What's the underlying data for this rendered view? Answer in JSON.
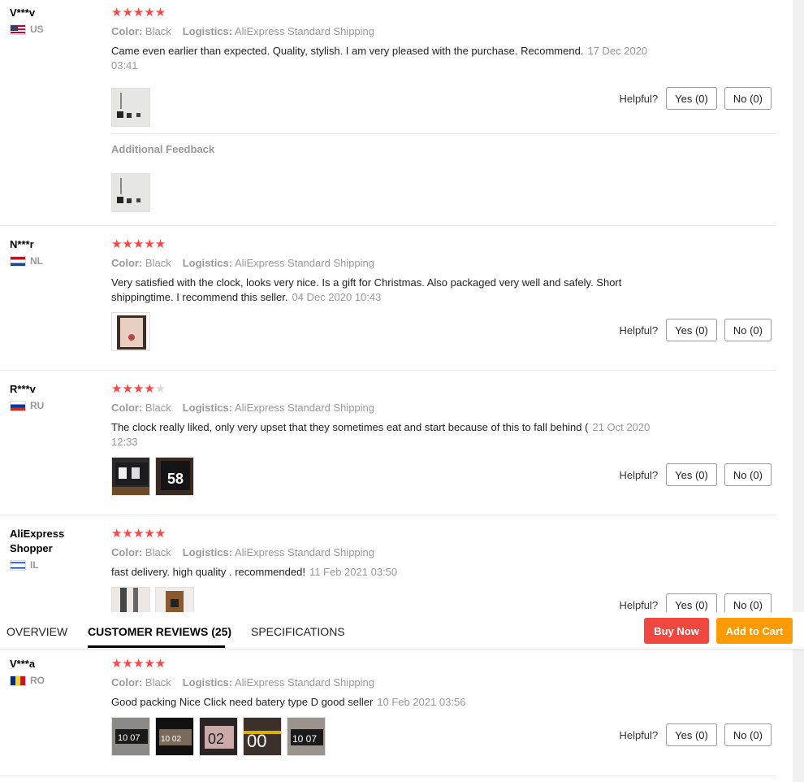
{
  "helpful_label": "Helpful?",
  "labels": {
    "color": "Color:",
    "logistics": "Logistics:"
  },
  "additional_feedback": "Additional Feedback",
  "reviews": [
    {
      "user": "V***v",
      "country": "US",
      "stars": "★★★★★",
      "stars_off": "",
      "rating": 5,
      "color": "Black",
      "logistics": "AliExpress Standard Shipping",
      "text": "Came even earlier than expected. Quality, stylish. I am very pleased with the purchase. Recommend.",
      "date": "17 Dec 2020 03:41",
      "yes": "Yes (0)",
      "no": "No (0)"
    },
    {
      "user": "N***r",
      "country": "NL",
      "stars": "★★★★★",
      "stars_off": "",
      "rating": 5,
      "color": "Black",
      "logistics": "AliExpress Standard Shipping",
      "text": "Very satisfied with the clock, looks very nice. Is a gift for Christmas. Also packaged very well and safely. Short shippingtime. I recommend this seller.",
      "date": "04 Dec 2020 10:43",
      "yes": "Yes (0)",
      "no": "No (0)"
    },
    {
      "user": "R***v",
      "country": "RU",
      "stars": "★★★★",
      "stars_off": "★",
      "rating": 4,
      "color": "Black",
      "logistics": "AliExpress Standard Shipping",
      "text": "The clock really liked, only very upset that they sometimes eat and start because of this to fall behind (",
      "date": "21 Oct 2020 12:33",
      "yes": "Yes (0)",
      "no": "No (0)"
    },
    {
      "user": "AliExpress Shopper",
      "country": "IL",
      "stars": "★★★★★",
      "stars_off": "",
      "rating": 5,
      "color": "Black",
      "logistics": "AliExpress Standard Shipping",
      "text": "fast delivery. high quality . recommended!",
      "date": "11 Feb 2021 03:50",
      "yes": "Yes (0)",
      "no": "No (0)"
    },
    {
      "user": "V***a",
      "country": "RO",
      "stars": "★★★★★",
      "stars_off": "",
      "rating": 5,
      "color": "Black",
      "logistics": "AliExpress Standard Shipping",
      "text": "Good packing Nice Click need batery type D good seller",
      "date": "10 Feb 2021 03:56",
      "yes": "Yes (0)",
      "no": "No (0)"
    }
  ],
  "tabs": {
    "overview": "OVERVIEW",
    "reviews": "CUSTOMER REVIEWS (25)",
    "specs": "SPECIFICATIONS"
  },
  "actions": {
    "buy": "Buy Now",
    "cart": "Add to Cart"
  },
  "colors": {
    "star": "#ff4747",
    "buy": "#f0483e",
    "cart": "#ff9a00"
  },
  "photo_texts": [
    "10 07",
    "10 02",
    "02",
    "00",
    "10 07"
  ]
}
